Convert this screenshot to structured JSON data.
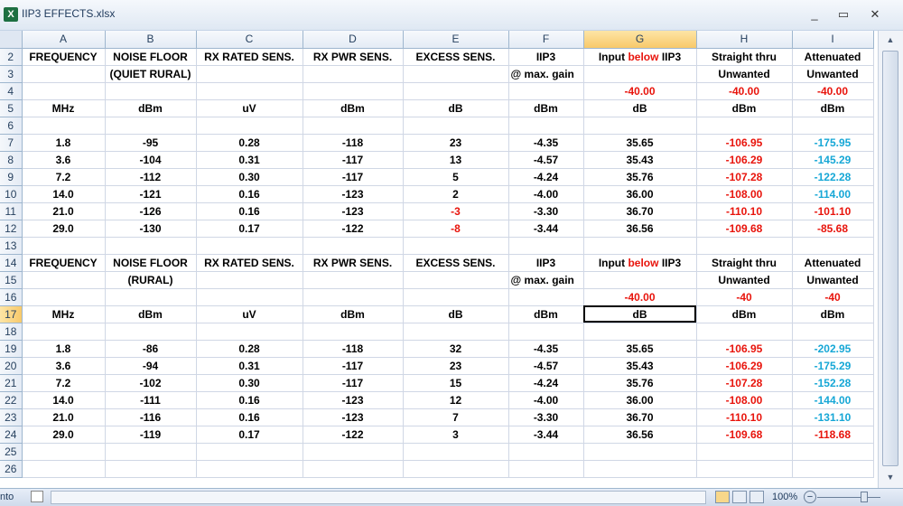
{
  "window": {
    "title": "IIP3 EFFECTS.xlsx",
    "icon": "excel-icon",
    "minimize": "_",
    "maximize": "▭",
    "close": "✕"
  },
  "columns": [
    "A",
    "B",
    "C",
    "D",
    "E",
    "F",
    "G",
    "H",
    "I"
  ],
  "rows": [
    {
      "n": "2",
      "cells": [
        "FREQUENCY",
        "NOISE FLOOR",
        "RX RATED SENS.",
        "RX PWR SENS.",
        "EXCESS SENS.",
        "IIP3",
        "INPUTBELOW",
        "Straight thru",
        "Attenuated"
      ]
    },
    {
      "n": "3",
      "cells": [
        "",
        "(QUIET RURAL)",
        "",
        "",
        "",
        "@ max. gain",
        "",
        "Unwanted",
        "Unwanted"
      ]
    },
    {
      "n": "4",
      "cells": [
        "",
        "",
        "",
        "",
        "",
        "",
        "-40.00",
        "-40.00",
        "-40.00"
      ]
    },
    {
      "n": "5",
      "cells": [
        "MHz",
        "dBm",
        "uV",
        "dBm",
        "dB",
        "dBm",
        "dB",
        "dBm",
        "dBm"
      ]
    },
    {
      "n": "6",
      "cells": [
        "",
        "",
        "",
        "",
        "",
        "",
        "",
        "",
        ""
      ]
    },
    {
      "n": "7",
      "cells": [
        "1.8",
        "-95",
        "0.28",
        "-118",
        "23",
        "-4.35",
        "35.65",
        "-106.95",
        "-175.95"
      ]
    },
    {
      "n": "8",
      "cells": [
        "3.6",
        "-104",
        "0.31",
        "-117",
        "13",
        "-4.57",
        "35.43",
        "-106.29",
        "-145.29"
      ]
    },
    {
      "n": "9",
      "cells": [
        "7.2",
        "-112",
        "0.30",
        "-117",
        "5",
        "-4.24",
        "35.76",
        "-107.28",
        "-122.28"
      ]
    },
    {
      "n": "10",
      "cells": [
        "14.0",
        "-121",
        "0.16",
        "-123",
        "2",
        "-4.00",
        "36.00",
        "-108.00",
        "-114.00"
      ]
    },
    {
      "n": "11",
      "cells": [
        "21.0",
        "-126",
        "0.16",
        "-123",
        "-3",
        "-3.30",
        "36.70",
        "-110.10",
        "-101.10"
      ]
    },
    {
      "n": "12",
      "cells": [
        "29.0",
        "-130",
        "0.17",
        "-122",
        "-8",
        "-3.44",
        "36.56",
        "-109.68",
        "-85.68"
      ]
    },
    {
      "n": "13",
      "cells": [
        "",
        "",
        "",
        "",
        "",
        "",
        "",
        "",
        ""
      ]
    },
    {
      "n": "14",
      "cells": [
        "FREQUENCY",
        "NOISE FLOOR",
        "RX RATED SENS.",
        "RX PWR SENS.",
        "EXCESS SENS.",
        "IIP3",
        "INPUTBELOW",
        "Straight thru",
        "Attenuated"
      ]
    },
    {
      "n": "15",
      "cells": [
        "",
        "(RURAL)",
        "",
        "",
        "",
        "@ max. gain",
        "",
        "Unwanted",
        "Unwanted"
      ]
    },
    {
      "n": "16",
      "cells": [
        "",
        "",
        "",
        "",
        "",
        "",
        "-40.00",
        "-40",
        "-40"
      ]
    },
    {
      "n": "17",
      "cells": [
        "MHz",
        "dBm",
        "uV",
        "dBm",
        "dB",
        "dBm",
        "dB",
        "dBm",
        "dBm"
      ]
    },
    {
      "n": "18",
      "cells": [
        "",
        "",
        "",
        "",
        "",
        "",
        "",
        "",
        ""
      ]
    },
    {
      "n": "19",
      "cells": [
        "1.8",
        "-86",
        "0.28",
        "-118",
        "32",
        "-4.35",
        "35.65",
        "-106.95",
        "-202.95"
      ]
    },
    {
      "n": "20",
      "cells": [
        "3.6",
        "-94",
        "0.31",
        "-117",
        "23",
        "-4.57",
        "35.43",
        "-106.29",
        "-175.29"
      ]
    },
    {
      "n": "21",
      "cells": [
        "7.2",
        "-102",
        "0.30",
        "-117",
        "15",
        "-4.24",
        "35.76",
        "-107.28",
        "-152.28"
      ]
    },
    {
      "n": "22",
      "cells": [
        "14.0",
        "-111",
        "0.16",
        "-123",
        "12",
        "-4.00",
        "36.00",
        "-108.00",
        "-144.00"
      ]
    },
    {
      "n": "23",
      "cells": [
        "21.0",
        "-116",
        "0.16",
        "-123",
        "7",
        "-3.30",
        "36.70",
        "-110.10",
        "-131.10"
      ]
    },
    {
      "n": "24",
      "cells": [
        "29.0",
        "-119",
        "0.17",
        "-122",
        "3",
        "-3.44",
        "36.56",
        "-109.68",
        "-118.68"
      ]
    },
    {
      "n": "25",
      "cells": [
        "",
        "",
        "",
        "",
        "",
        "",
        "",
        "",
        ""
      ]
    },
    {
      "n": "26",
      "cells": [
        "",
        "",
        "",
        "",
        "",
        "",
        "",
        "",
        ""
      ]
    }
  ],
  "input_below": {
    "pre": "Input ",
    "red": "below",
    "post": " IIP3"
  },
  "selection": {
    "row": "17",
    "col": "G"
  },
  "status": {
    "mode": "nto",
    "zoom": "100%"
  },
  "colors": {
    "red": "#e8140c",
    "blue": "#16a7d6"
  }
}
